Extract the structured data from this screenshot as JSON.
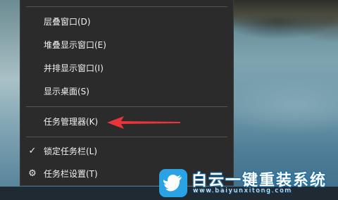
{
  "context_menu": {
    "items": [
      {
        "label": "层叠窗口(D)",
        "icon": ""
      },
      {
        "label": "堆叠显示窗口(E)",
        "icon": ""
      },
      {
        "label": "并排显示窗口(I)",
        "icon": ""
      },
      {
        "label": "显示桌面(S)",
        "icon": ""
      },
      {
        "label": "任务管理器(K)",
        "icon": ""
      },
      {
        "label": "锁定任务栏(L)",
        "icon": "checkmark-icon",
        "checked": true
      },
      {
        "label": "任务栏设置(T)",
        "icon": "gear-icon"
      }
    ]
  },
  "annotation": {
    "arrow_color": "#e8343a",
    "points_to": "任务管理器(K)"
  },
  "watermark": {
    "title": "白云一键重装系统",
    "url": "www.baiyunxitong.com",
    "brand_color": "#2aa3e4"
  },
  "glyphs": {
    "check": "✓",
    "gear": "⚙"
  }
}
